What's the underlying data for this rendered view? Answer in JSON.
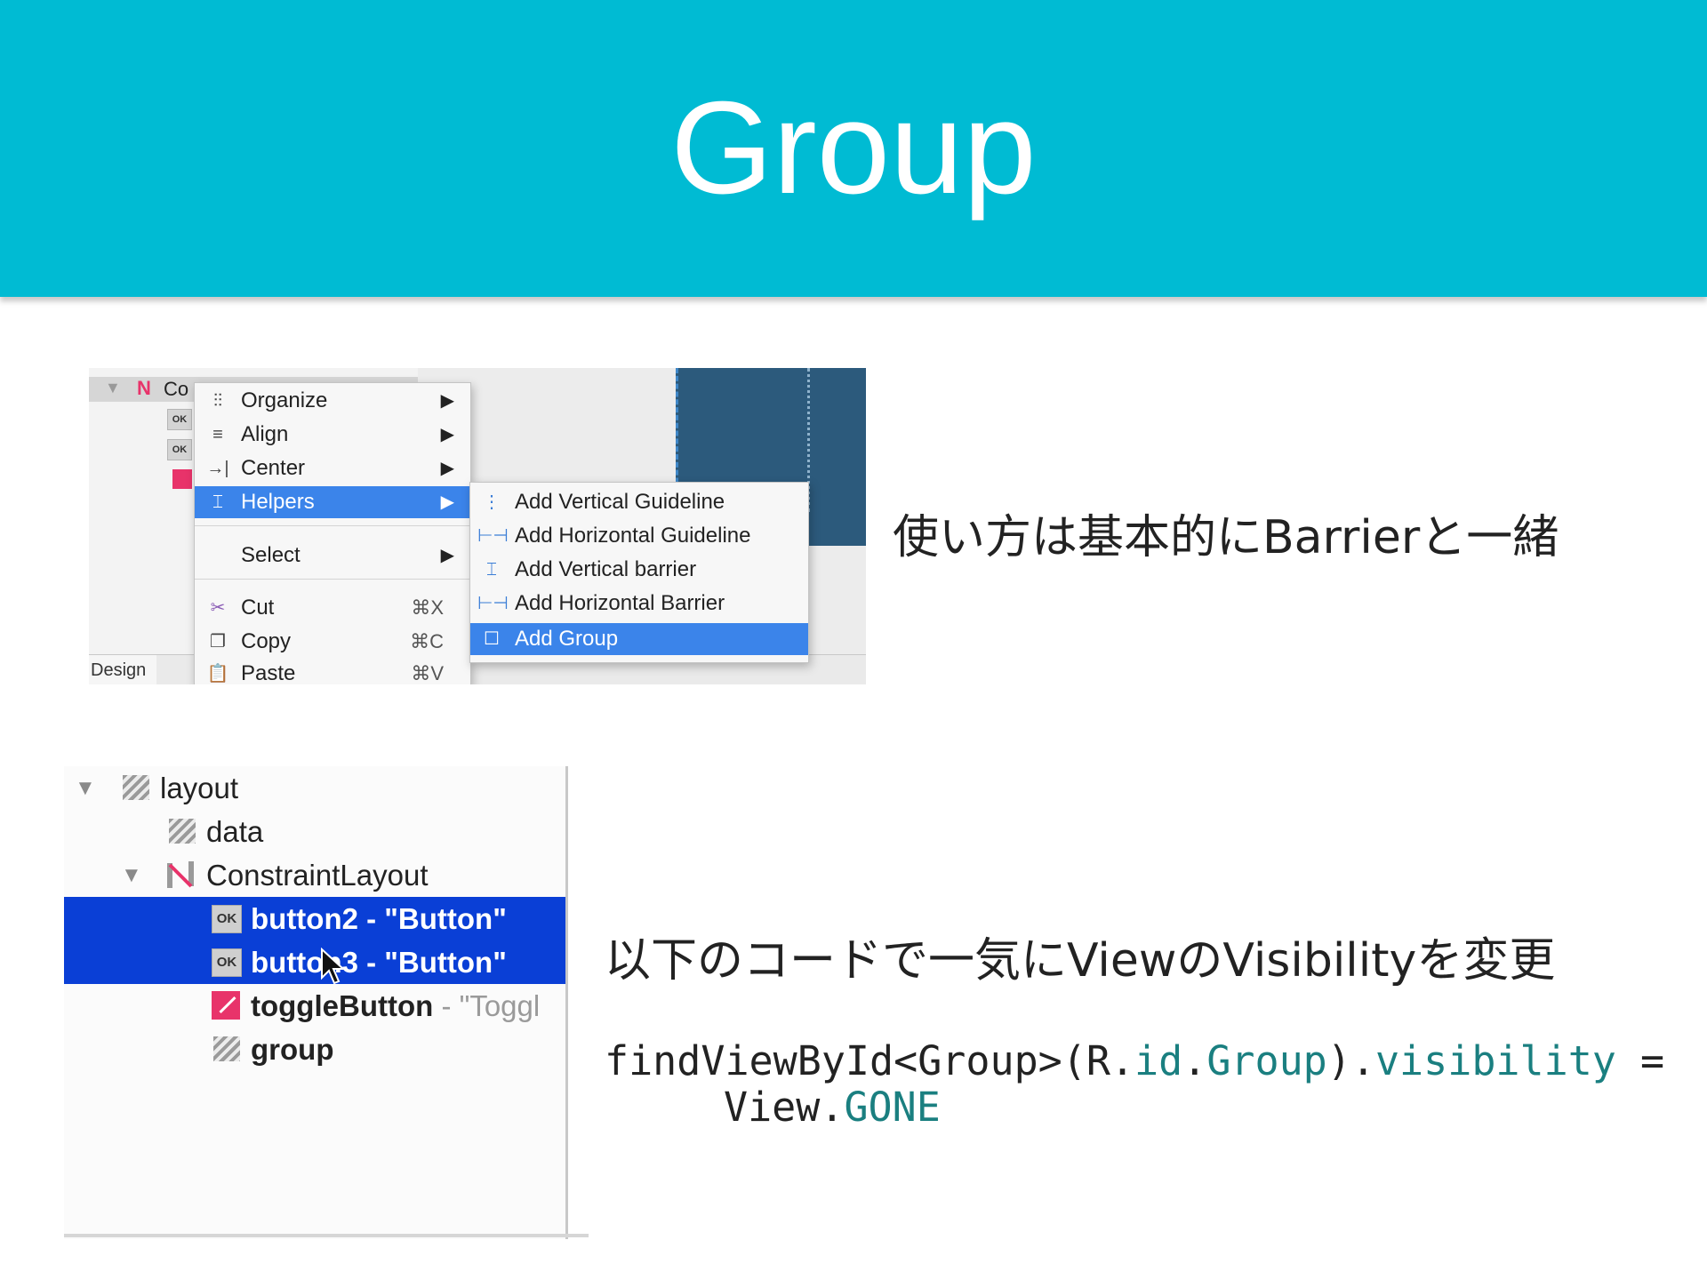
{
  "slide": {
    "title": "Group"
  },
  "screenshot1": {
    "tree_label": "Co",
    "ok_badge": "OK",
    "design_tab": "Design",
    "context_menu": [
      {
        "label": "Organize",
        "icon": "organize-icon",
        "arrow": "▶"
      },
      {
        "label": "Align",
        "icon": "align-icon",
        "arrow": "▶"
      },
      {
        "label": "Center",
        "icon": "center-icon",
        "arrow": "▶"
      },
      {
        "label": "Helpers",
        "icon": "helpers-icon",
        "arrow": "▶",
        "selected": true
      },
      {
        "label": "Select",
        "icon": "",
        "arrow": "▶"
      },
      {
        "label": "Cut",
        "icon": "scissors-icon",
        "shortcut": "⌘X"
      },
      {
        "label": "Copy",
        "icon": "copy-icon",
        "shortcut": "⌘C"
      },
      {
        "label": "Paste",
        "icon": "paste-icon",
        "shortcut": "⌘V"
      }
    ],
    "submenu": [
      {
        "label": "Add Vertical Guideline",
        "icon": "vertical-guideline-icon"
      },
      {
        "label": "Add Horizontal Guideline",
        "icon": "horizontal-guideline-icon"
      },
      {
        "label": "Add Vertical barrier",
        "icon": "vertical-barrier-icon"
      },
      {
        "label": "Add Horizontal Barrier",
        "icon": "horizontal-barrier-icon"
      },
      {
        "label": "Add Group",
        "icon": "group-icon",
        "selected": true
      }
    ],
    "accent_color": "#3b84ea",
    "blueprint_color": "#2c5a7c"
  },
  "description1": "使い方は基本的にBarrierと一緒",
  "screenshot2": {
    "rows": [
      {
        "name": "layout",
        "kind": "hatch",
        "expanded": true
      },
      {
        "name": "data",
        "kind": "hatch"
      },
      {
        "name": "ConstraintLayout",
        "kind": "constraint",
        "expanded": true
      },
      {
        "name": "button2 - \"Button\"",
        "kind": "ok",
        "selected": true
      },
      {
        "name": "button3 - \"Button\"",
        "kind": "ok",
        "selected": true
      },
      {
        "name": "toggleButton",
        "suffix": " - \"Toggl",
        "kind": "toggle"
      },
      {
        "name": "group",
        "kind": "hatch"
      }
    ],
    "ok_badge": "OK",
    "selection_color": "#0a3fd6"
  },
  "description2": "以下のコードで一気にViewのVisibilityを変更",
  "code": {
    "line1_a": "findViewById<Group>(R.",
    "line1_b": "id",
    "line1_c": ".",
    "line1_d": "Group",
    "line1_e": ").",
    "line1_f": "visibility",
    "line1_g": " =",
    "line2_a": "View.",
    "line2_b": "GONE"
  },
  "colors": {
    "header": "#00bbd3",
    "code_highlight": "#1a7f80"
  }
}
